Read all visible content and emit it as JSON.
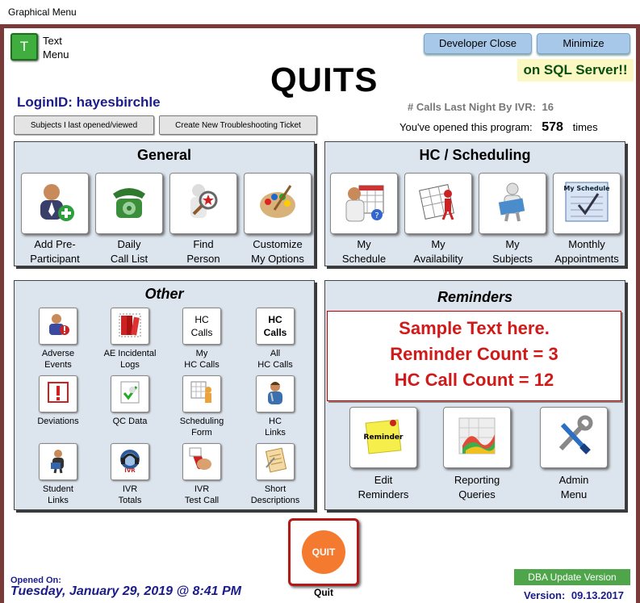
{
  "window": {
    "title": "Graphical Menu"
  },
  "header": {
    "text_menu_icon_letter": "T",
    "text_menu_line1": "Text",
    "text_menu_line2": "Menu",
    "developer_close_label": "Developer Close",
    "minimize_label": "Minimize",
    "sql_server_text": "on SQL Server!!",
    "app_title": "QUITS"
  },
  "login": {
    "label": "LoginID:",
    "user": "hayesbirchle"
  },
  "stats": {
    "calls_label": "# Calls Last Night By IVR:",
    "calls_value": "16",
    "opened_label": "You've opened this program:",
    "opened_value": "578",
    "opened_suffix": "times"
  },
  "toolbar": {
    "subjects_btn": "Subjects I last opened/viewed",
    "ticket_btn": "Create New Troubleshooting Ticket"
  },
  "general": {
    "title": "General",
    "buttons": [
      {
        "l1": "Add Pre-",
        "l2": "Participant",
        "icon": "add-person-icon"
      },
      {
        "l1": "Daily",
        "l2": "Call List",
        "icon": "telephone-icon"
      },
      {
        "l1": "Find",
        "l2": "Person",
        "icon": "find-person-icon"
      },
      {
        "l1": "Customize",
        "l2": "My Options",
        "icon": "palette-icon"
      }
    ]
  },
  "hc": {
    "title": "HC / Scheduling",
    "buttons": [
      {
        "l1": "My",
        "l2": "Schedule",
        "icon": "doctor-calendar-icon"
      },
      {
        "l1": "My",
        "l2": "Availability",
        "icon": "calendar-person-icon"
      },
      {
        "l1": "My",
        "l2": "Subjects",
        "icon": "reading-person-icon"
      },
      {
        "l1": "Monthly",
        "l2": "Appointments",
        "icon": "schedule-checklist-icon",
        "tag": "My Schedule"
      }
    ]
  },
  "other": {
    "title": "Other",
    "buttons": [
      {
        "l1": "Adverse",
        "l2": "Events",
        "icon": "adverse-events-icon"
      },
      {
        "l1": "AE Incidental",
        "l2": "Logs",
        "icon": "books-icon"
      },
      {
        "l1": "My",
        "l2": "HC Calls",
        "icon": "text-icon",
        "t1": "HC",
        "t2": "Calls"
      },
      {
        "l1": "All",
        "l2": "HC Calls",
        "icon": "text-icon",
        "t1": "HC",
        "t2": "Calls"
      },
      {
        "l1": "Deviations",
        "l2": "",
        "icon": "warning-icon"
      },
      {
        "l1": "QC Data",
        "l2": "",
        "icon": "check-icon"
      },
      {
        "l1": "Scheduling",
        "l2": "Form",
        "icon": "scheduling-form-icon"
      },
      {
        "l1": "HC",
        "l2": "Links",
        "icon": "nurse-icon"
      },
      {
        "l1": "Student",
        "l2": "Links",
        "icon": "student-icon"
      },
      {
        "l1": "IVR",
        "l2": "Totals",
        "icon": "ivr-headset-icon"
      },
      {
        "l1": "IVR",
        "l2": "Test Call",
        "icon": "phone-hand-icon"
      },
      {
        "l1": "Short",
        "l2": "Descriptions",
        "icon": "notepad-icon"
      }
    ]
  },
  "reminders": {
    "title": "Reminders",
    "line1": "Sample Text here.",
    "line2": "Reminder Count = 3",
    "line3": "HC Call Count = 12",
    "buttons": [
      {
        "l1": "Edit",
        "l2": "Reminders",
        "icon": "sticky-note-icon",
        "note": "Reminder"
      },
      {
        "l1": "Reporting",
        "l2": "Queries",
        "icon": "chart-3d-icon"
      },
      {
        "l1": "Admin",
        "l2": "Menu",
        "icon": "tools-icon"
      }
    ]
  },
  "footer": {
    "opened_on_label": "Opened On:",
    "opened_on_value": "Tuesday, January 29, 2019 @ 8:41 PM",
    "quit_icon_text": "QUIT",
    "quit_label": "Quit",
    "dba_label": "DBA Update Version",
    "version_label": "Version:",
    "version_value": "09.13.2017"
  },
  "colors": {
    "frame": "#7b3a3a",
    "panel": "#dce4ee",
    "accent": "#1b1b8a",
    "reminder_text": "#d01a1a",
    "quit": "#f47a30"
  }
}
